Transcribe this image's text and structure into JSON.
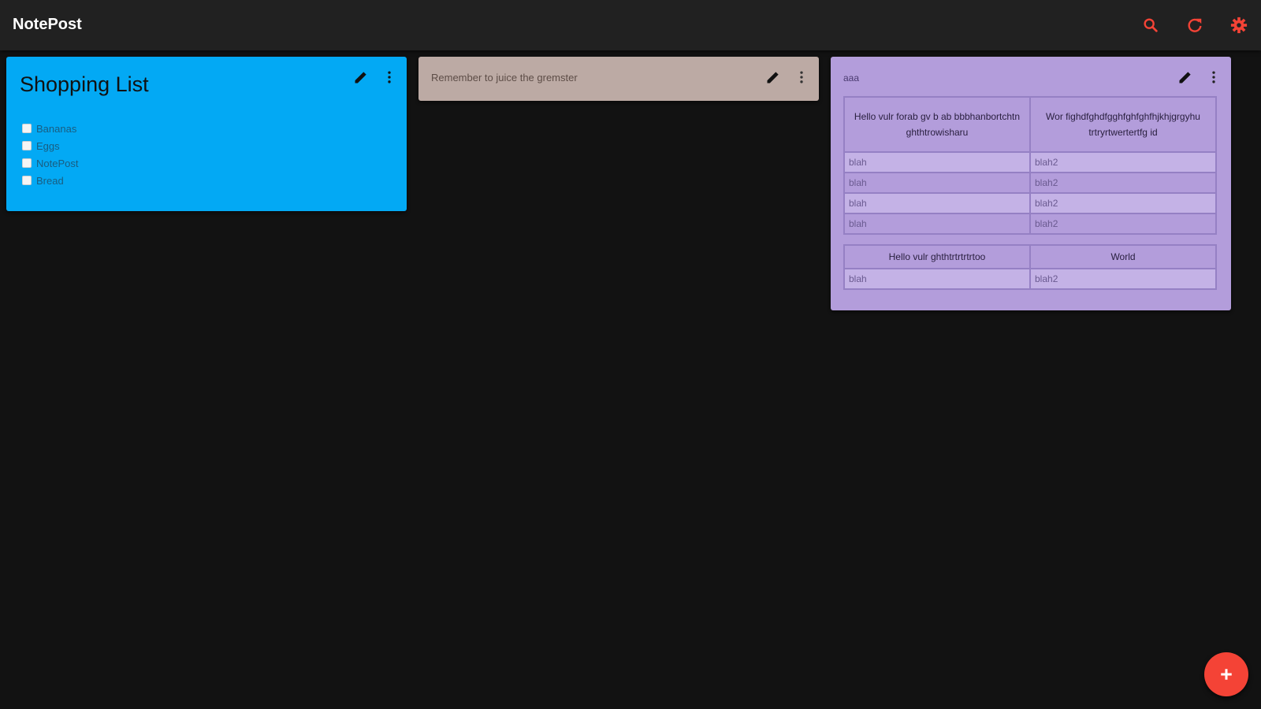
{
  "app": {
    "title": "NotePost",
    "accent_color": "#f44336",
    "icons": [
      "search-icon",
      "refresh-icon",
      "settings-icon"
    ]
  },
  "notes": [
    {
      "color": "#03a9f4",
      "title": "Shopping List",
      "items": [
        {
          "label": "Bananas",
          "checked": false
        },
        {
          "label": "Eggs",
          "checked": false
        },
        {
          "label": "NotePost",
          "checked": false
        },
        {
          "label": "Bread",
          "checked": false
        }
      ]
    },
    {
      "color": "#bcaaa4",
      "text": "Remember to juice the gremster"
    },
    {
      "color": "#b39ddb",
      "title": "aaa",
      "table1": {
        "headers": [
          "Hello vulr forab gv b ab bbbhanbortchtn ghthtrowisharu",
          "Wor fighdfghdfgghfghfghfhjkhjgrgyhu trtryrtwertertfg id"
        ],
        "rows": [
          [
            "blah",
            "blah2"
          ],
          [
            "blah",
            "blah2"
          ],
          [
            "blah",
            "blah2"
          ],
          [
            "blah",
            "blah2"
          ]
        ]
      },
      "table2": {
        "headers": [
          "Hello vulr ghthtrtrtrtrtoo",
          "World"
        ],
        "rows": [
          [
            "blah",
            "blah2"
          ]
        ]
      }
    }
  ],
  "fab": {
    "icon": "plus-icon",
    "label": "+"
  }
}
